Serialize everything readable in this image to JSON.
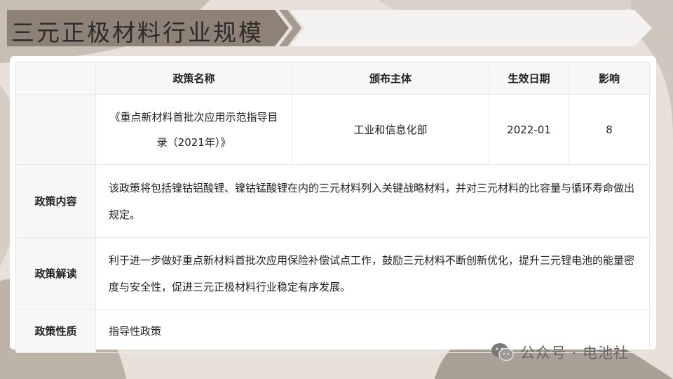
{
  "page": {
    "title": "三元正极材料行业规模",
    "colors": {
      "accent": "#8d8275",
      "banner": "#f3f2f0",
      "background": "#e7e1d9"
    }
  },
  "table": {
    "headers": [
      "政策名称",
      "颁布主体",
      "生效日期",
      "影响"
    ],
    "policy": {
      "name": "《重点新材料首批次应用示范指导目录（2021年）》",
      "issuer": "工业和信息化部",
      "effective_date": "2022-01",
      "impact": "8"
    },
    "rows": [
      {
        "label": "政策内容",
        "text": "该政策将包括镍钴铝酸锂、镍钴锰酸锂在内的三元材料列入关键战略材料，并对三元材料的比容量与循环寿命做出规定。"
      },
      {
        "label": "政策解读",
        "text": "利于进一步做好重点新材料首批次应用保险补偿试点工作，鼓励三元材料不断创新优化，提升三元锂电池的能量密度与安全性，促进三元正极材料行业稳定有序发展。"
      },
      {
        "label": "政策性质",
        "text": "指导性政策"
      }
    ]
  },
  "watermark": {
    "text": "公众号 · 电池社",
    "icon": "wechat-icon"
  }
}
